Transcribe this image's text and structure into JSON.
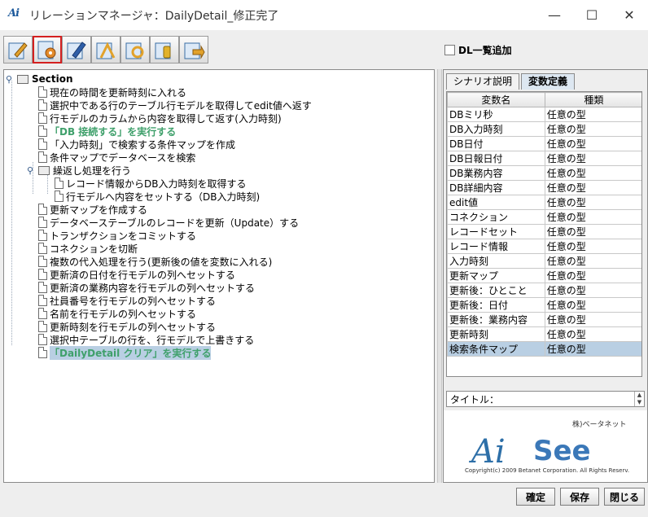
{
  "window": {
    "app_icon": "Ai",
    "title": "リレーションマネージャ：DailyDetail_修正完了",
    "minimize": "—",
    "maximize": "☐",
    "close": "✕"
  },
  "toolbar": {
    "buttons": [
      {
        "icon": "edit-icon"
      },
      {
        "icon": "settings-icon"
      },
      {
        "icon": "book-edit-icon"
      },
      {
        "icon": "wizard-icon"
      },
      {
        "icon": "refresh-icon"
      },
      {
        "icon": "key-icon"
      },
      {
        "icon": "export-icon"
      }
    ]
  },
  "dl_checkbox": {
    "label": "DL一覧追加",
    "checked": false
  },
  "tree": {
    "root": "Section",
    "items": [
      "現在の時間を更新時刻に入れる",
      "選択中である行のテーブル行モデルを取得してedit値へ返す",
      "行モデルのカラムから内容を取得して返す(入力時刻)",
      "「DB 接続する」を実行する",
      "「入力時刻」で検索する条件マップを作成",
      "条件マップでデータベースを検索",
      "繰返し処理を行う",
      "レコード情報からDB入力時刻を取得する",
      "行モデルへ内容をセットする（DB入力時刻)",
      "更新マップを作成する",
      "データベーステーブルのレコードを更新（Update）する",
      "トランザクションをコミットする",
      "コネクションを切断",
      "複数の代入処理を行う(更新後の値を変数に入れる)",
      "更新済の日付を行モデルの列へセットする",
      "更新済の業務内容を行モデルの列へセットする",
      "社員番号を行モデルの列へセットする",
      "名前を行モデルの列へセットする",
      "更新時刻を行モデルの列へセットする",
      "選択中テーブルの行を、行モデルで上書きする",
      "「DailyDetail クリア」を実行する"
    ]
  },
  "tabs": [
    "シナリオ説明",
    "変数定義"
  ],
  "variables": {
    "headers": [
      "変数名",
      "種類"
    ],
    "rows": [
      [
        "DBミリ秒",
        "任意の型"
      ],
      [
        "DB入力時刻",
        "任意の型"
      ],
      [
        "DB日付",
        "任意の型"
      ],
      [
        "DB日報日付",
        "任意の型"
      ],
      [
        "DB業務内容",
        "任意の型"
      ],
      [
        "DB詳細内容",
        "任意の型"
      ],
      [
        "edit値",
        "任意の型"
      ],
      [
        "コネクション",
        "任意の型"
      ],
      [
        "レコードセット",
        "任意の型"
      ],
      [
        "レコード情報",
        "任意の型"
      ],
      [
        "入力時刻",
        "任意の型"
      ],
      [
        "更新マップ",
        "任意の型"
      ],
      [
        "更新後：ひとこと",
        "任意の型"
      ],
      [
        "更新後：日付",
        "任意の型"
      ],
      [
        "更新後：業務内容",
        "任意の型"
      ],
      [
        "更新時刻",
        "任意の型"
      ],
      [
        "検索条件マップ",
        "任意の型"
      ]
    ]
  },
  "title_field": {
    "label": "タイトル："
  },
  "logo": {
    "company": "株)ベータネット",
    "ai": "Ai",
    "see": "See",
    "copyright": "Copyright(c) 2009 Betanet Corporation. All Rights Reserv."
  },
  "buttons": {
    "ok": "確定",
    "save": "保存",
    "close": "閉じる"
  }
}
